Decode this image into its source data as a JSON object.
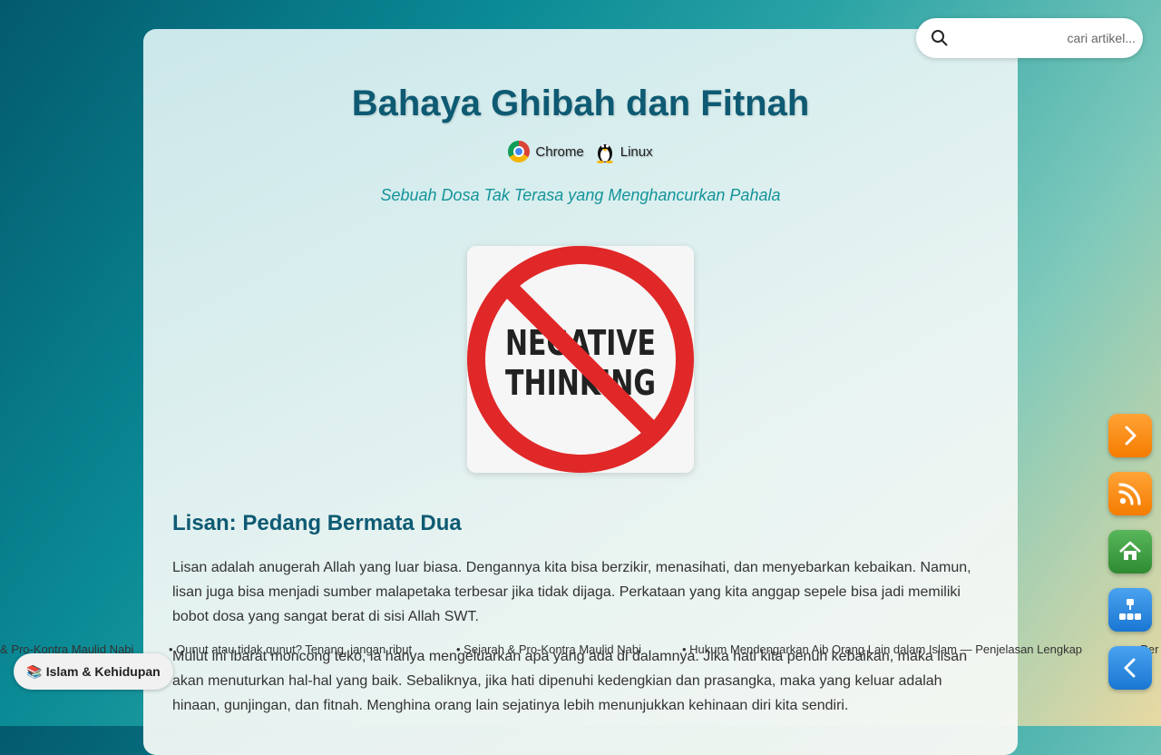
{
  "article": {
    "title": "Bahaya Ghibah dan Fitnah",
    "meta": [
      {
        "icon": "chrome-icon",
        "label": "Chrome"
      },
      {
        "icon": "linux-tux-icon",
        "label": "Linux"
      }
    ],
    "subtitle": "Sebuah Dosa Tak Terasa yang Menghancurkan Pahala",
    "hero_image": {
      "line1": "NEGATIVE",
      "line2": "THINKING"
    },
    "section_heading": "Lisan: Pedang Bermata Dua",
    "paragraphs": [
      "Lisan adalah anugerah Allah yang luar biasa. Dengannya kita bisa berzikir, menasihati, dan menyebarkan kebaikan. Namun, lisan juga bisa menjadi sumber malapetaka terbesar jika tidak dijaga. Perkataan yang kita anggap sepele bisa jadi memiliki bobot dosa yang sangat berat di sisi Allah SWT.",
      "Mulut ini ibarat moncong teko, ia hanya mengeluarkan apa yang ada di dalamnya. Jika hati kita penuh kebaikan, maka lisan akan menuturkan hal-hal yang baik. Sebaliknya, jika hati dipenuhi kedengkian dan prasangka, maka yang keluar adalah hinaan, gunjingan, dan fitnah. Menghina orang lain sejatinya lebih menunjukkan kehinaan diri kita sendiri."
    ]
  },
  "search": {
    "placeholder": "cari artikel..."
  },
  "ticker": [
    "& Pro-Kontra Maulid Nabi",
    "• Qunut atau tidak qunut? Tenang, jangan ribut",
    "• Sejarah & Pro-Kontra Maulid Nabi",
    "• Hukum Mendengarkan Aib Orang Lain dalam Islam — Penjelasan Lengkap",
    "• Per"
  ],
  "category_badge": {
    "icon": "books-icon",
    "emoji": "📚",
    "label": "Islam & Kehidupan"
  },
  "fabs": [
    {
      "name": "next-button",
      "icon": "chevron-right-icon",
      "color": "#f57c00"
    },
    {
      "name": "rss-button",
      "icon": "rss-icon",
      "color": "#f57c00"
    },
    {
      "name": "home-button",
      "icon": "home-icon",
      "color": "#2e8b32"
    },
    {
      "name": "sitemap-button",
      "icon": "sitemap-icon",
      "color": "#1976d2"
    },
    {
      "name": "back-button",
      "icon": "chevron-left-icon",
      "color": "#1976d2"
    }
  ]
}
